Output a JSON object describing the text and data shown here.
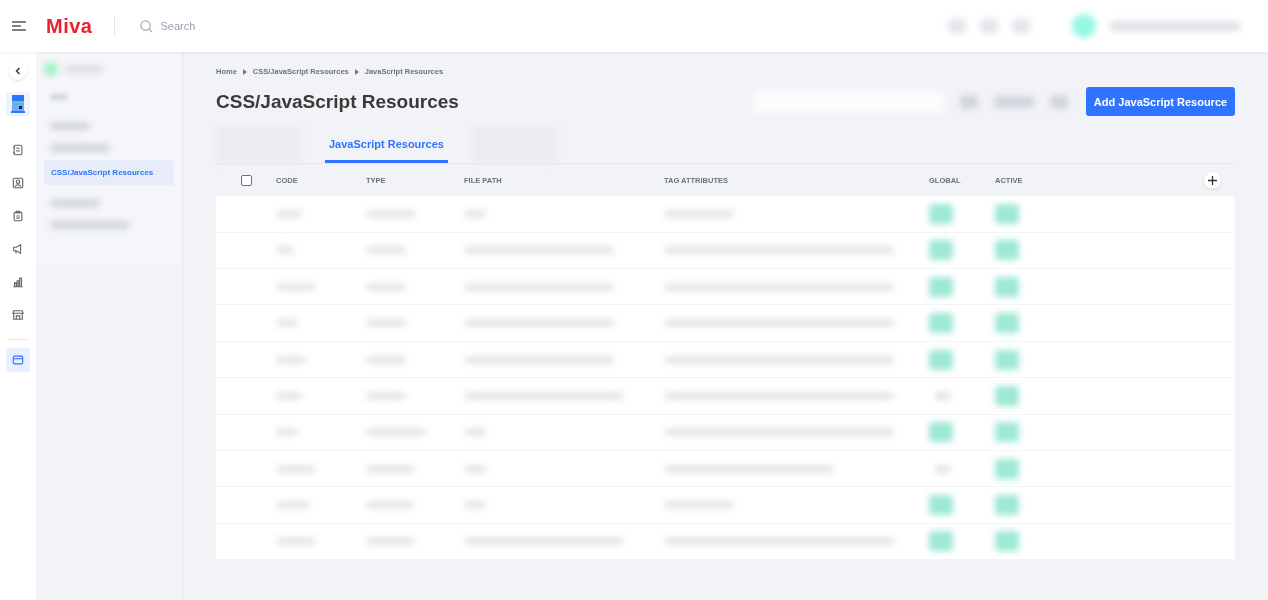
{
  "header": {
    "logo": "Miva",
    "search": {
      "placeholder": "Search"
    }
  },
  "rail": [
    {
      "selected": false
    },
    {
      "selected": false
    },
    {
      "selected": false
    },
    {
      "selected": false
    },
    {
      "selected": false
    },
    {
      "selected": false
    },
    {
      "selected": true
    }
  ],
  "sidebar": {
    "items": [
      {
        "selected": false
      },
      {
        "selected": false
      },
      {
        "label": "CSS/JavaScript Resources",
        "selected": true
      },
      {
        "selected": false
      },
      {
        "selected": false
      }
    ]
  },
  "breadcrumb": [
    "Home",
    "CSS/JavaScript Resources",
    "JavaScript Resources"
  ],
  "page_title": "CSS/JavaScript Resources",
  "primary_button": "Add JavaScript Resource",
  "tabs": [
    {
      "selected": false
    },
    {
      "label": "JavaScript Resources",
      "selected": true
    },
    {
      "selected": false
    }
  ],
  "table": {
    "select_all_checked": false,
    "columns": [
      "CODE",
      "TYPE",
      "FILE PATH",
      "TAG ATTRIBUTES",
      "GLOBAL",
      "ACTIVE"
    ],
    "rows": [
      {
        "global": true,
        "active": true
      },
      {
        "global": true,
        "active": true
      },
      {
        "global": true,
        "active": true
      },
      {
        "global": true,
        "active": true
      },
      {
        "global": true,
        "active": true
      },
      {
        "global": false,
        "active": true
      },
      {
        "global": true,
        "active": true
      },
      {
        "global": false,
        "active": true
      },
      {
        "global": true,
        "active": true
      },
      {
        "global": true,
        "active": true
      }
    ]
  }
}
